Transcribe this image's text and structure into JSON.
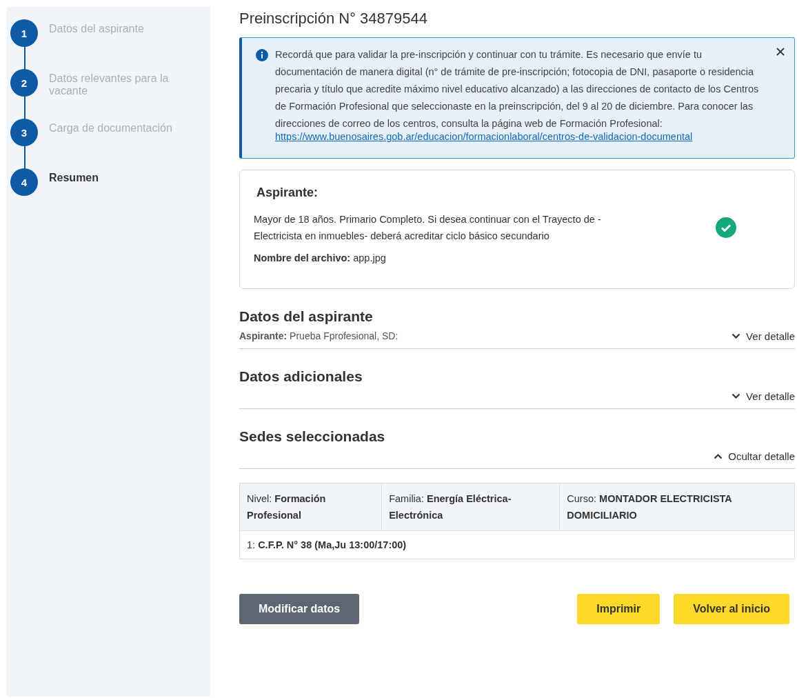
{
  "steps": [
    {
      "number": "1",
      "label": "Datos del aspirante",
      "selected": false
    },
    {
      "number": "2",
      "label": "Datos relevantes para la vacante",
      "selected": false
    },
    {
      "number": "3",
      "label": "Carga de documentación",
      "selected": false
    },
    {
      "number": "4",
      "label": "Resumen",
      "selected": true
    }
  ],
  "title": "Preinscripción N° 34879544",
  "alert": {
    "text": "Recordá que para validar la pre-inscripción y continuar con tu trámite. Es necesario que envíe tu documentación de manera digital (n° de trámite de pre-inscripción; fotocopia de DNI, pasaporte o residencia precaria y título que acredite máximo nivel educativo alcanzado) a las direcciones de contacto de los Centros de Formación Profesional que seleccionaste en la preinscripción, del 9 al 20 de diciembre. Para conocer las direcciones de correo de los centros, consulta la página web de Formación Profesional:",
    "link": "https://www.buenosaires.gob.ar/educacion/formacionlaboral/centros-de-validacion-documental"
  },
  "card": {
    "title": "Aspirante:",
    "description": "Mayor de 18 años. Primario Completo. Si desea continuar con el Trayecto de -Electricista en inmuebles- deberá acreditar ciclo básico secundario",
    "file": "**Nombre del archivo:** app.jpg",
    "checked": true
  },
  "sections": [
    {
      "title": "Datos del aspirante",
      "summary": "**Aspirante:** Prueba Fprofesional, SD:",
      "toggle": "Ver detalle",
      "expanded": false
    },
    {
      "title": "Datos adicionales",
      "toggle": "Ver detalle",
      "expanded": false
    },
    {
      "title": "Sedes seleccionadas",
      "toggle": "Ocultar detalle",
      "expanded": true
    }
  ],
  "table": {
    "columns": [
      "Nivel: **Formación Profesional**",
      "Familia: **Energía Eléctrica-Electrónica**",
      "Curso: **MONTADOR ELECTRICISTA DOMICILIARIO**"
    ],
    "rows": [
      "1: **C.F.P. N° 38 (Ma,Ju 13:00/17:00)**"
    ]
  },
  "buttons": [
    {
      "label": "Modificar datos",
      "kind": "secondary"
    },
    {
      "label": "Imprimir",
      "kind": "primary"
    },
    {
      "label": "Volver al inicio",
      "kind": "primary"
    }
  ]
}
